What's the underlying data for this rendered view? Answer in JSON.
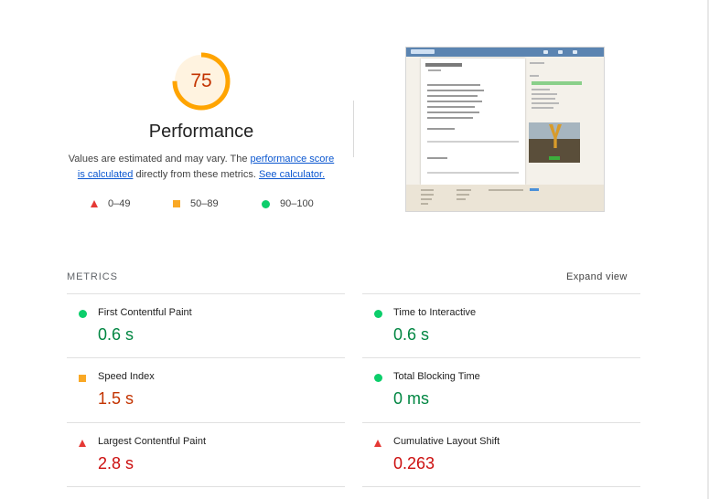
{
  "score": {
    "value": "75",
    "fraction": 0.75,
    "ring_color": "#ffa400",
    "track_color": "#fff3e0"
  },
  "category": {
    "title": "Performance",
    "desc_prefix": "Values are estimated and may vary. The ",
    "desc_link1": "performance score is calculated",
    "desc_middle": " directly from these metrics. ",
    "desc_link2": "See calculator."
  },
  "legend": [
    {
      "shape": "triangle-red-icon",
      "range": "0–49"
    },
    {
      "shape": "square-orange-icon",
      "range": "50–89"
    },
    {
      "shape": "circle-green-icon",
      "range": "90–100"
    }
  ],
  "metrics_section": {
    "heading": "METRICS",
    "expand_label": "Expand view"
  },
  "metrics": [
    {
      "label": "First Contentful Paint",
      "value": "0.6 s",
      "rating": "pass"
    },
    {
      "label": "Time to Interactive",
      "value": "0.6 s",
      "rating": "pass"
    },
    {
      "label": "Speed Index",
      "value": "1.5 s",
      "rating": "average"
    },
    {
      "label": "Total Blocking Time",
      "value": "0 ms",
      "rating": "pass"
    },
    {
      "label": "Largest Contentful Paint",
      "value": "2.8 s",
      "rating": "fail"
    },
    {
      "label": "Cumulative Layout Shift",
      "value": "0.263",
      "rating": "fail"
    }
  ],
  "colors": {
    "pass": "#0cce6b",
    "average": "#ffa400",
    "fail": "#ff4e42",
    "link": "#0b57d0"
  }
}
